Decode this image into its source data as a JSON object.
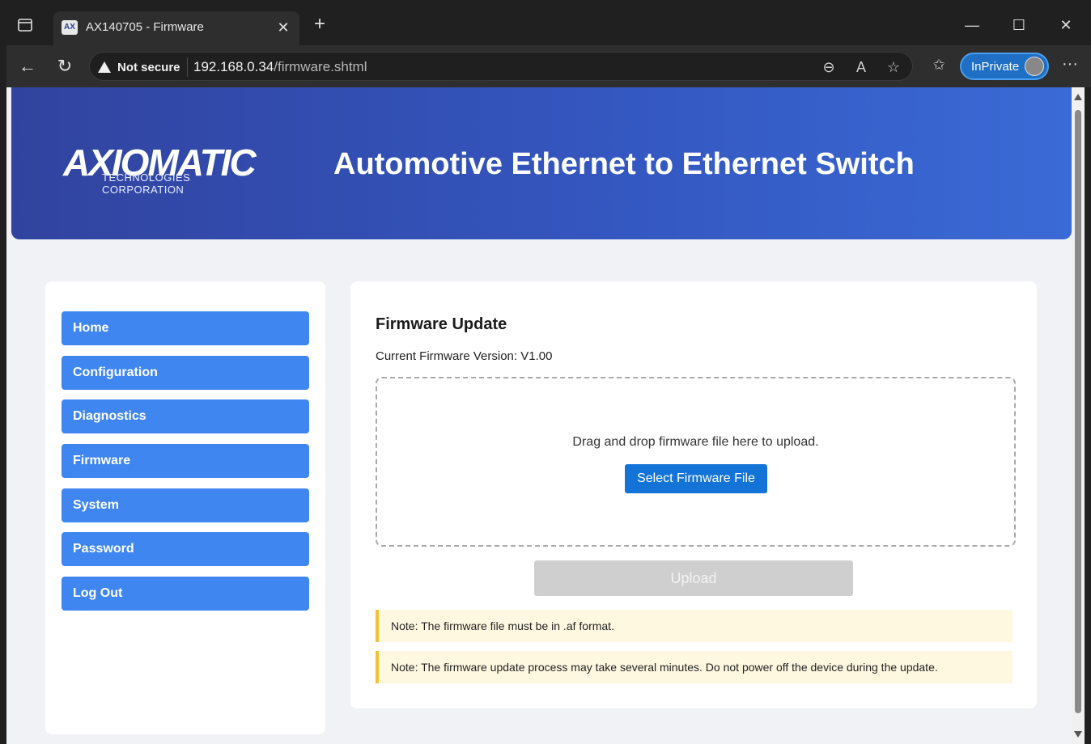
{
  "browser": {
    "tab_title": "AX140705 - Firmware",
    "favicon_text": "AX",
    "security_label": "Not secure",
    "url_host": "192.168.0.34",
    "url_path": "/firmware.shtml",
    "inprivate_label": "InPrivate"
  },
  "header": {
    "logo_text": "AXIOMATIC",
    "logo_subtext": "TECHNOLOGIES CORPORATION",
    "title": "Automotive Ethernet to Ethernet Switch"
  },
  "sidebar": {
    "items": [
      {
        "label": "Home"
      },
      {
        "label": "Configuration"
      },
      {
        "label": "Diagnostics"
      },
      {
        "label": "Firmware"
      },
      {
        "label": "System"
      },
      {
        "label": "Password"
      },
      {
        "label": "Log Out"
      }
    ]
  },
  "main": {
    "title": "Firmware Update",
    "version_text": "Current Firmware Version: V1.00",
    "dropzone_text": "Drag and drop firmware file here to upload.",
    "select_button": "Select Firmware File",
    "upload_button": "Upload",
    "notes": [
      "Note: The firmware file must be in .af format.",
      "Note: The firmware update process may take several minutes. Do not power off the device during the update."
    ]
  },
  "colors": {
    "header_start": "#31439f",
    "header_end": "#3a6ad6",
    "nav_button": "#3f86f0",
    "select_button": "#1473d6",
    "upload_disabled": "#cfcfcf",
    "note_bg": "#fff8e1",
    "note_border": "#f1c232"
  }
}
